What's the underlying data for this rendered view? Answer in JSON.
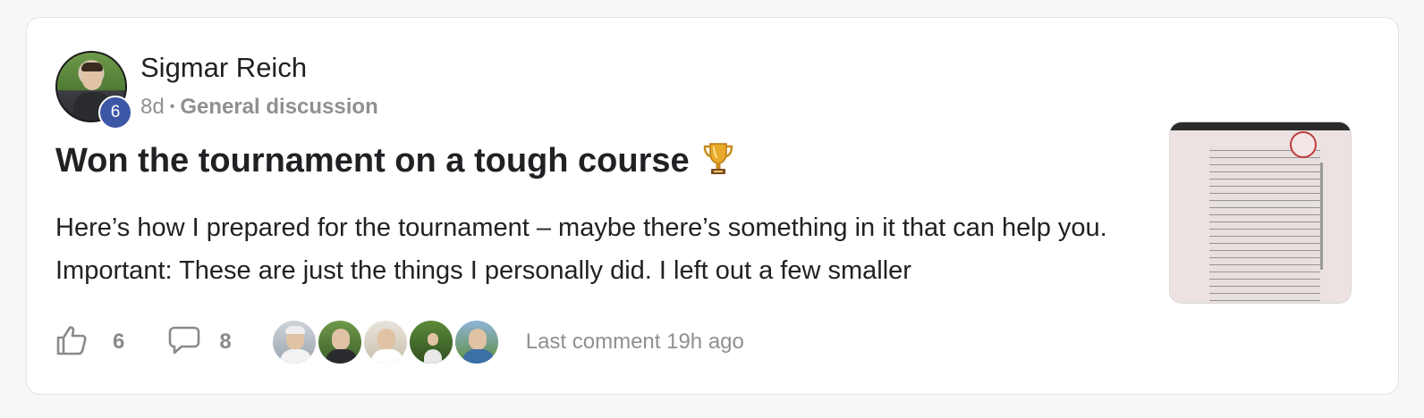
{
  "post": {
    "author": {
      "name": "Sigmar Reich",
      "level": "6"
    },
    "age": "8d",
    "separator": "•",
    "category": "General discussion",
    "title": "Won the tournament on a tough course",
    "title_emoji": "trophy-icon",
    "excerpt": "Here’s how I prepared for the tournament – maybe there’s something in it that can help you. Important: These are just the things I personally did. I left out a few smaller",
    "thumbnail": "results-table-screenshot",
    "likes": "6",
    "comments": "8",
    "participants_count": 5,
    "last_comment": "Last comment 19h ago"
  },
  "colors": {
    "level_badge": "#3d57a7",
    "muted_text": "#909090",
    "title_text": "#202124",
    "card_bg": "#ffffff",
    "page_bg": "#f8f7f5"
  }
}
